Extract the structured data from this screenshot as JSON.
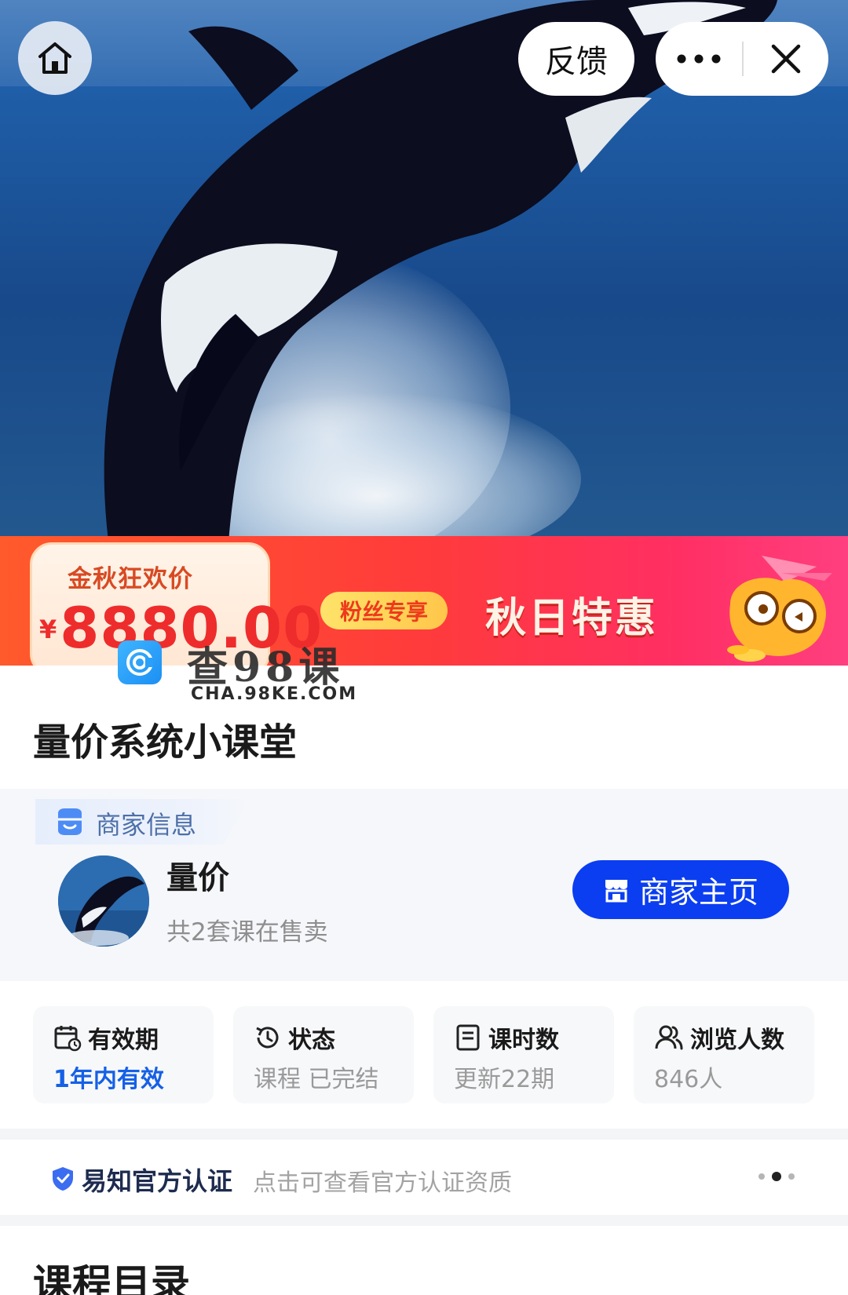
{
  "nav": {
    "feedback_label": "反馈",
    "home_icon": "home-icon",
    "more_icon": "more-icon",
    "close_icon": "close-icon"
  },
  "promo": {
    "label": "金秋狂欢价",
    "currency": "¥",
    "price": "8880.00",
    "fans_tag": "粉丝专享",
    "headline": "秋日特惠",
    "accent": "#ff3b3b"
  },
  "watermark": {
    "title": "查98课",
    "url": "CHA.98KE.COM"
  },
  "course": {
    "title": "量价系统小课堂"
  },
  "merchant": {
    "section_label": "商家信息",
    "name": "量价",
    "course_count": "共2套课在售卖",
    "home_button": "商家主页",
    "button_color": "#0b3ef1"
  },
  "stats": [
    {
      "label": "有效期",
      "value": "1年内有效",
      "icon": "calendar-icon"
    },
    {
      "label": "状态",
      "value": "课程 已完结",
      "icon": "history-icon"
    },
    {
      "label": "课时数",
      "value": "更新22期",
      "icon": "document-icon"
    },
    {
      "label": "浏览人数",
      "value": "846人",
      "icon": "users-icon"
    }
  ],
  "certification": {
    "title": "易知官方认证",
    "description": "点击可查看官方认证资质"
  },
  "catalog": {
    "title": "课程目录"
  }
}
